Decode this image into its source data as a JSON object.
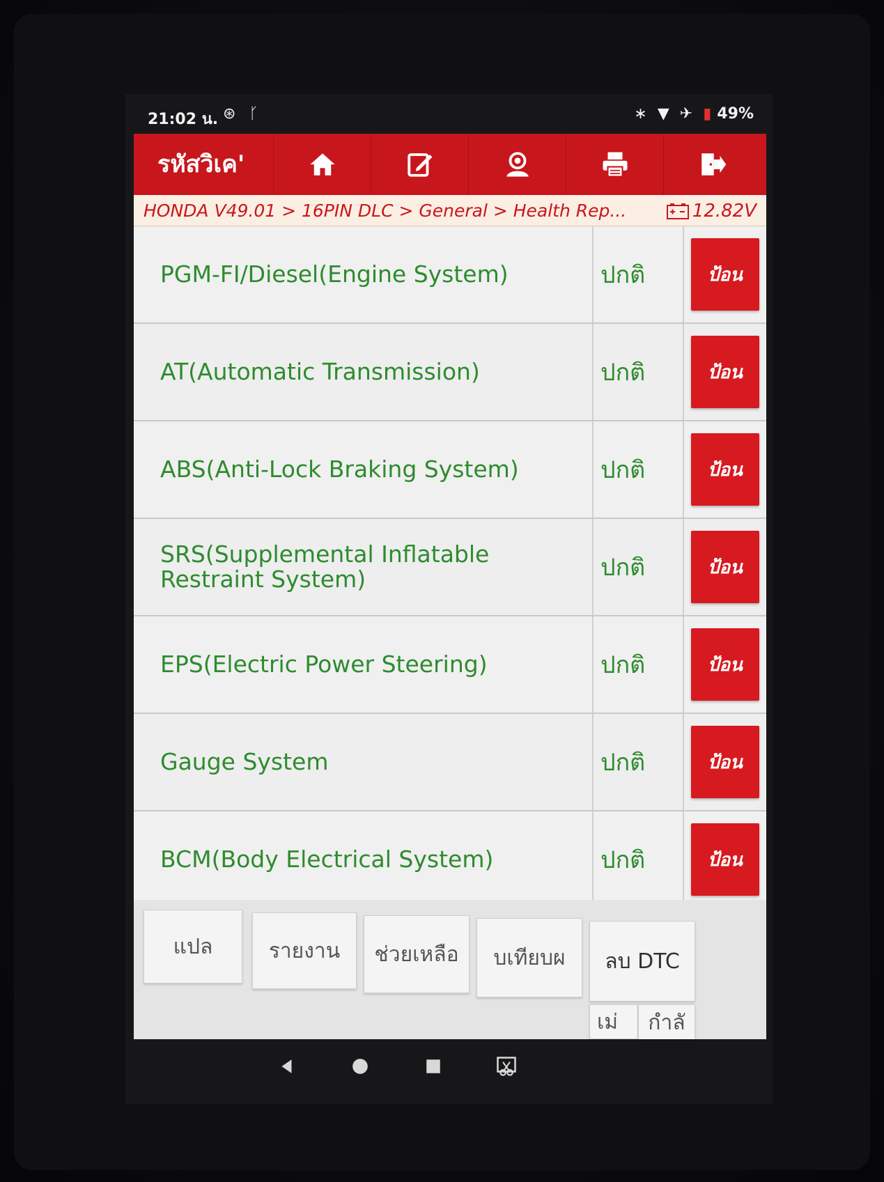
{
  "status_bar": {
    "time": "21:02 น.",
    "left_icons": [
      "settings-badge-icon",
      "usb-icon"
    ],
    "right_icons": [
      "bluetooth-icon",
      "wifi-icon",
      "airplane-icon"
    ],
    "battery": "49%"
  },
  "toolbar": {
    "title": "รหัสวิเค'",
    "buttons": [
      "home-icon",
      "edit-icon",
      "user-icon",
      "print-icon",
      "exit-icon"
    ]
  },
  "breadcrumb": {
    "path": "HONDA V49.01 > 16PIN DLC > General > Health Rep...",
    "voltage": "12.82V"
  },
  "systems": [
    {
      "name": "PGM-FI/Diesel(Engine System)",
      "status": "ปกติ",
      "action": "ป้อน"
    },
    {
      "name": "AT(Automatic Transmission)",
      "status": "ปกติ",
      "action": "ป้อน"
    },
    {
      "name": "ABS(Anti-Lock Braking System)",
      "status": "ปกติ",
      "action": "ป้อน"
    },
    {
      "name": "SRS(Supplemental Inflatable Restraint System)",
      "status": "ปกติ",
      "action": "ป้อน"
    },
    {
      "name": "EPS(Electric Power Steering)",
      "status": "ปกติ",
      "action": "ป้อน"
    },
    {
      "name": "Gauge System",
      "status": "ปกติ",
      "action": "ป้อน"
    },
    {
      "name": "BCM(Body Electrical System)",
      "status": "ปกติ",
      "action": "ป้อน"
    }
  ],
  "function_buttons": {
    "translate": "แปล",
    "report": "รายงาน",
    "help": "ช่วยเหลือ",
    "compare": "บเทียบผ",
    "clear_dtc": "ลบ DTC",
    "bottom_left": "เม่",
    "bottom_right": "กำลั"
  },
  "colors": {
    "accent_red": "#c8161d",
    "status_green": "#2e8b2e"
  }
}
